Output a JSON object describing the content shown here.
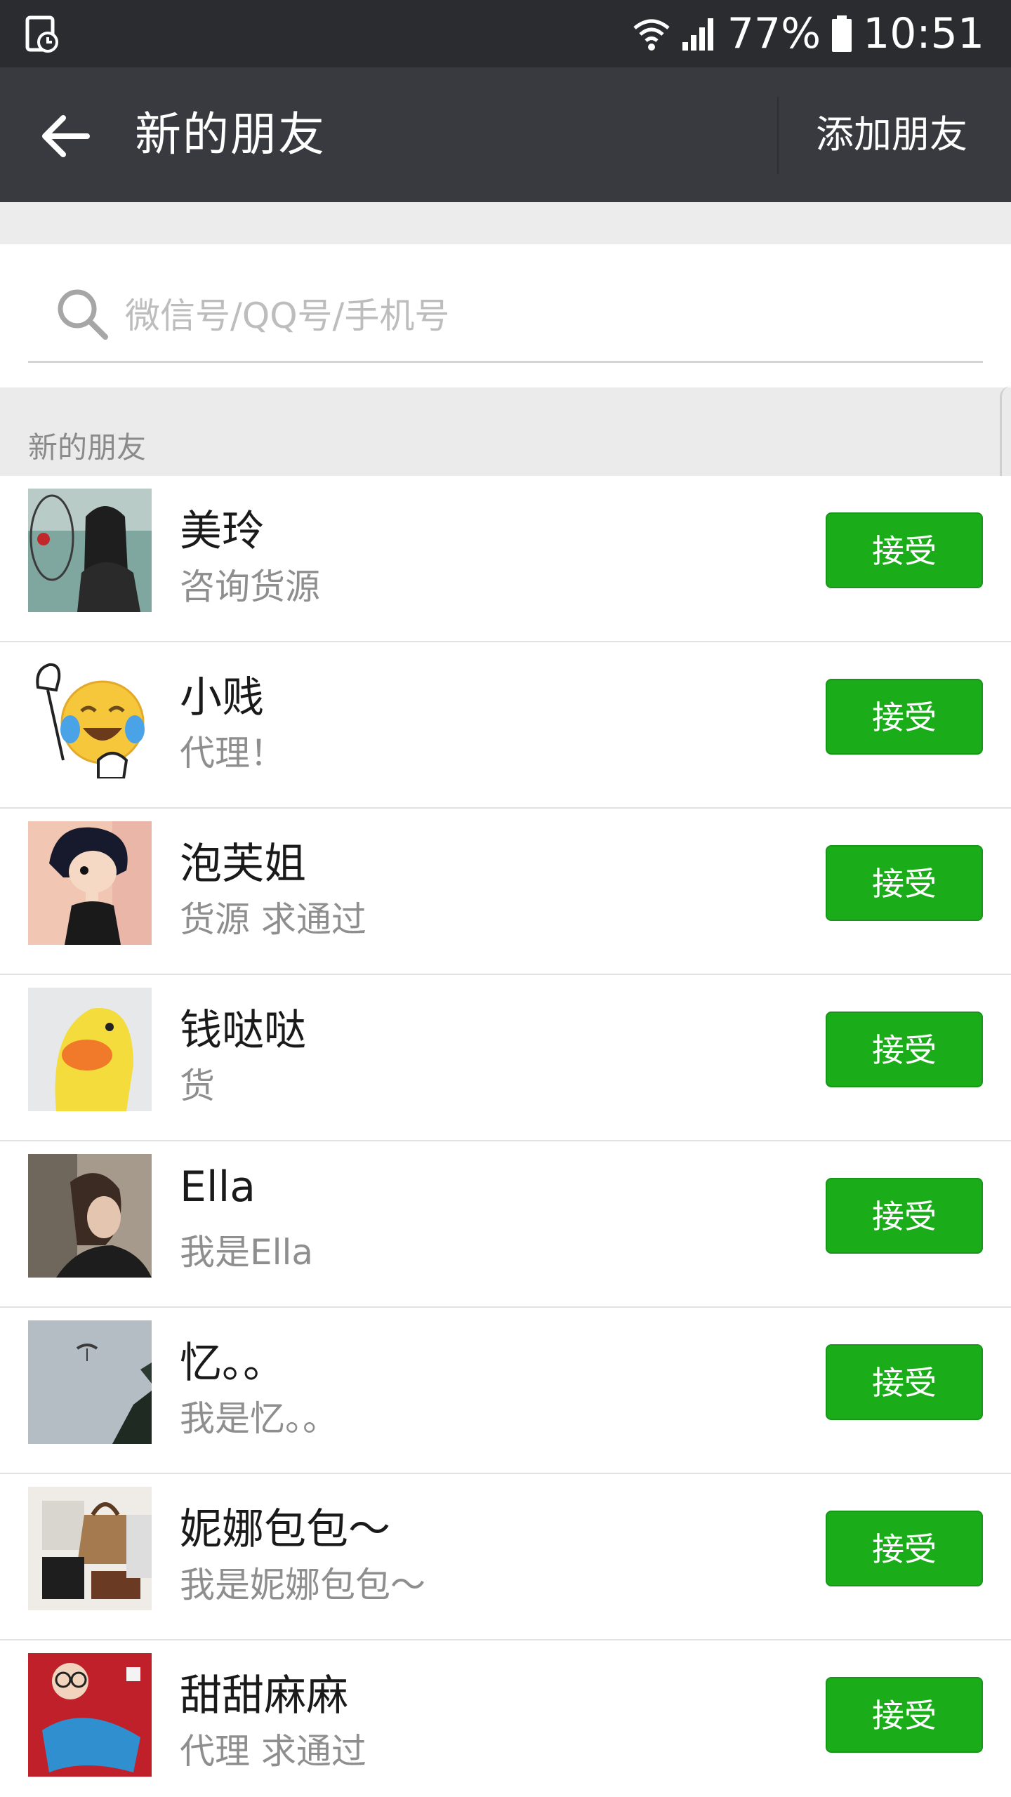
{
  "status_bar": {
    "battery": "77%",
    "time": "10:51",
    "icons": [
      "screen-recorder-icon",
      "wifi-icon",
      "cellular-signal-icon",
      "battery-icon"
    ]
  },
  "app_bar": {
    "title": "新的朋友",
    "action": "添加朋友",
    "back_icon": "back-arrow-icon"
  },
  "search": {
    "placeholder": "微信号/QQ号/手机号",
    "value": "",
    "icon": "search-icon"
  },
  "section": {
    "header": "新的朋友"
  },
  "colors": {
    "accent_green": "#1aad19",
    "app_bar": "#393a3f",
    "status_bar": "#2b2c30"
  },
  "friend_requests": [
    {
      "name": "美玲",
      "message": "咨询货源",
      "button": "接受"
    },
    {
      "name": "小贱",
      "message": "代理！",
      "button": "接受"
    },
    {
      "name": "泡芙姐",
      "message": "货源  求通过",
      "button": "接受"
    },
    {
      "name": "钱哒哒",
      "message": "货",
      "button": "接受"
    },
    {
      "name": "Ella",
      "message": "我是Ella",
      "button": "接受"
    },
    {
      "name": "忆。。",
      "message": "我是忆。。",
      "button": "接受"
    },
    {
      "name": "妮娜包包～",
      "message": "我是妮娜包包～",
      "button": "接受"
    },
    {
      "name": "甜甜麻麻",
      "message": "代理 求通过",
      "button": "接受"
    }
  ]
}
